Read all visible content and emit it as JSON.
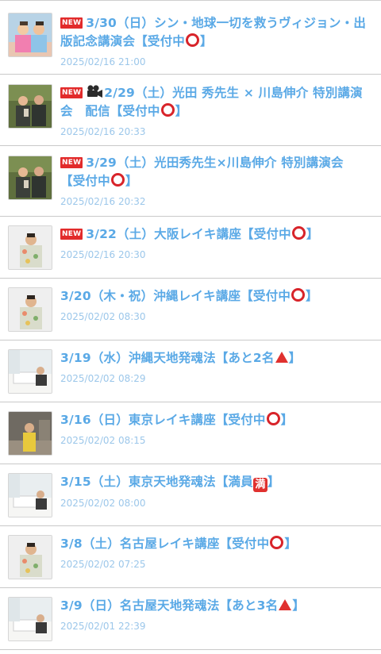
{
  "posts": [
    {
      "badge": "NEW",
      "title_a": "3/30（日）シン・地球一切を救うヴィジョン・出版記念講演会【受付中",
      "title_b": "】",
      "date": "2025/02/16 21:00",
      "thumb": "two-people-colorful"
    },
    {
      "badge": "NEW",
      "camera": true,
      "title_a": "2/29（土）光田 秀先生 × 川島伸介 特別講演会　配信【受付中",
      "title_b": "】",
      "date": "2025/02/16 20:33",
      "thumb": "two-people-green"
    },
    {
      "badge": "NEW",
      "title_a": "3/29（土）光田秀先生×川島伸介 特別講演会【受付中",
      "title_b": "】",
      "date": "2025/02/16 20:32",
      "thumb": "two-people-green"
    },
    {
      "badge": "NEW",
      "title_a": "3/22（土）大阪レイキ講座【受付中",
      "title_b": "】",
      "date": "2025/02/16 20:30",
      "thumb": "man-floral"
    },
    {
      "title_a": "3/20（木・祝）沖縄レイキ講座【受付中",
      "title_b": "】",
      "date": "2025/02/02 08:30",
      "thumb": "man-floral"
    },
    {
      "title_a": "3/19（水）沖縄天地発魂法【あと2名",
      "title_b": "】",
      "symbol": "triangle",
      "date": "2025/02/02 08:29",
      "thumb": "room-session"
    },
    {
      "title_a": "3/16（日）東京レイキ講座【受付中",
      "title_b": "】",
      "date": "2025/02/02 08:15",
      "thumb": "man-yellow"
    },
    {
      "title_a": "3/15（土）東京天地発魂法【満員",
      "title_b": "】",
      "symbol": "full",
      "full_char": "満",
      "date": "2025/02/02 08:00",
      "thumb": "room-session"
    },
    {
      "title_a": "3/8（土）名古屋レイキ講座【受付中",
      "title_b": "】",
      "date": "2025/02/02 07:25",
      "thumb": "man-floral"
    },
    {
      "title_a": "3/9（日）名古屋天地発魂法【あと3名",
      "title_b": "】",
      "symbol": "triangle",
      "date": "2025/02/01 22:39",
      "thumb": "room-session"
    }
  ],
  "colors": {
    "title": "#5aa9e6",
    "date": "#9cc7ea",
    "badge": "#e22b2b",
    "circle": "#d8242a",
    "divider": "#c9c9c9"
  }
}
